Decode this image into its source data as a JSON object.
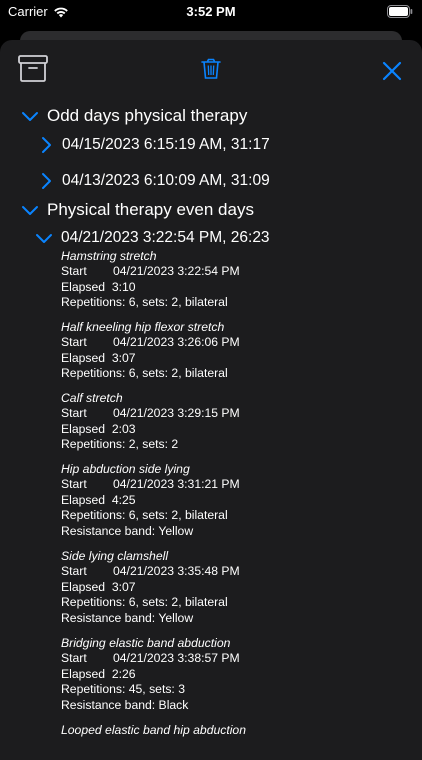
{
  "status_bar": {
    "carrier": "Carrier",
    "time": "3:52 PM"
  },
  "colors": {
    "accent": "#0a84ff",
    "sheet_background": "#1c1c1e",
    "text": "#ffffff"
  },
  "toolbar": {
    "archive_icon": "archive-icon",
    "trash_icon": "trash-icon",
    "close_icon": "close-icon"
  },
  "groups": [
    {
      "title": "Odd days physical therapy",
      "expanded": true,
      "sessions": [
        {
          "title": "04/15/2023 6:15:19 AM,  31:17",
          "expanded": false
        },
        {
          "title": "04/13/2023 6:10:09 AM,  31:09",
          "expanded": false
        }
      ]
    },
    {
      "title": "Physical therapy even days",
      "expanded": true,
      "sessions": [
        {
          "title": "04/21/2023 3:22:54 PM,  26:23",
          "expanded": true,
          "exercises": [
            {
              "name": "Hamstring stretch",
              "start_label": "Start",
              "start": "04/21/2023 3:22:54 PM",
              "elapsed_label": "Elapsed",
              "elapsed": "3:10",
              "reps": "Repetitions: 6, sets: 2, bilateral"
            },
            {
              "name": "Half kneeling hip flexor stretch",
              "start_label": "Start",
              "start": "04/21/2023 3:26:06 PM",
              "elapsed_label": "Elapsed",
              "elapsed": "3:07",
              "reps": "Repetitions: 6, sets: 2, bilateral"
            },
            {
              "name": "Calf stretch",
              "start_label": "Start",
              "start": "04/21/2023 3:29:15 PM",
              "elapsed_label": "Elapsed",
              "elapsed": "2:03",
              "reps": "Repetitions: 2, sets: 2"
            },
            {
              "name": "Hip abduction side lying",
              "start_label": "Start",
              "start": "04/21/2023 3:31:21 PM",
              "elapsed_label": "Elapsed",
              "elapsed": "4:25",
              "reps": "Repetitions: 6, sets: 2, bilateral",
              "band": "Resistance band: Yellow"
            },
            {
              "name": "Side lying clamshell",
              "start_label": "Start",
              "start": "04/21/2023 3:35:48 PM",
              "elapsed_label": "Elapsed",
              "elapsed": "3:07",
              "reps": "Repetitions: 6, sets: 2, bilateral",
              "band": "Resistance band: Yellow"
            },
            {
              "name": "Bridging elastic band abduction",
              "start_label": "Start",
              "start": "04/21/2023 3:38:57 PM",
              "elapsed_label": "Elapsed",
              "elapsed": "2:26",
              "reps": "Repetitions: 45, sets: 3",
              "band": "Resistance band: Black"
            },
            {
              "name": "Looped elastic band hip abduction"
            }
          ]
        }
      ]
    }
  ]
}
